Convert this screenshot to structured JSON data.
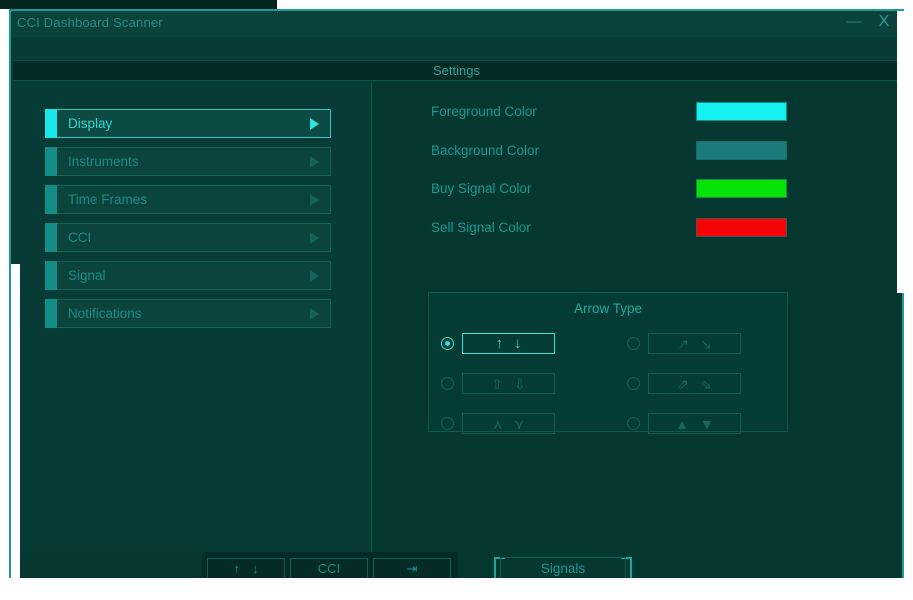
{
  "window": {
    "title": "CCI Dashboard Scanner",
    "minimize_label": "—",
    "close_label": "X"
  },
  "header": {
    "title": "Settings"
  },
  "sidebar": {
    "items": [
      {
        "label": "Display",
        "selected": true,
        "chevron": "chevron-right-icon"
      },
      {
        "label": "Instruments",
        "selected": false,
        "chevron": "chevron-right-icon"
      },
      {
        "label": "Time Frames",
        "selected": false,
        "chevron": "chevron-right-icon"
      },
      {
        "label": "CCI",
        "selected": false,
        "chevron": "chevron-right-icon"
      },
      {
        "label": "Signal",
        "selected": false,
        "chevron": "chevron-right-icon"
      },
      {
        "label": "Notifications",
        "selected": false,
        "chevron": "chevron-right-icon"
      }
    ]
  },
  "panel": {
    "colors": [
      {
        "label": "Foreground Color",
        "value": "#14F0F0"
      },
      {
        "label": "Background Color",
        "value": "#1A7A7A"
      },
      {
        "label": "Buy Signal Color",
        "value": "#06E206"
      },
      {
        "label": "Sell Signal Color",
        "value": "#F50505"
      }
    ],
    "arrow_type": {
      "title": "Arrow Type",
      "options": [
        {
          "up": "↑",
          "down": "↓",
          "selected": true,
          "name": "arrow-filled-up-down"
        },
        {
          "up": "⇧",
          "down": "⇩",
          "selected": false,
          "name": "arrow-outline-up-down"
        },
        {
          "up": "⋏",
          "down": "⋎",
          "selected": false,
          "name": "arrow-chevron-up-down"
        },
        {
          "up": "↗",
          "down": "↘",
          "selected": false,
          "name": "arrow-diagonal-up-down"
        },
        {
          "up": "⇗",
          "down": "⇘",
          "selected": false,
          "name": "arrow-diagonal-outline-up-down"
        },
        {
          "up": "▲",
          "down": "▼",
          "selected": false,
          "name": "arrow-triangle-up-down"
        }
      ]
    }
  },
  "toolbar": {
    "buttons": [
      {
        "label": "",
        "up": "↑",
        "down": "↓",
        "name": "arrows-button"
      },
      {
        "label": "CCI",
        "up": "",
        "down": "",
        "name": "cci-button"
      },
      {
        "label": "",
        "up": "⇥",
        "down": "",
        "name": "align-start-icon"
      }
    ],
    "signals_label": "Signals"
  }
}
